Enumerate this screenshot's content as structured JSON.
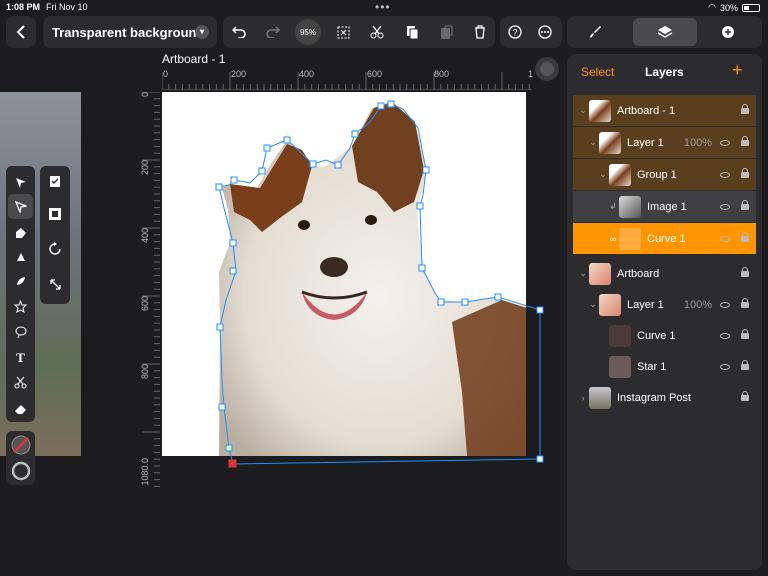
{
  "status": {
    "time": "1:08 PM",
    "date": "Fri Nov 10",
    "battery": "30%"
  },
  "document": {
    "title": "Transparent background",
    "zoom": "95%"
  },
  "artboard": {
    "label": "Artboard - 1"
  },
  "ruler": {
    "top_ticks": [
      "0",
      "200",
      "400",
      "600",
      "800",
      "1"
    ],
    "left_ticks": [
      "0",
      "200",
      "400",
      "600",
      "800",
      "1080.0"
    ]
  },
  "panel": {
    "select_label": "Select",
    "title": "Layers"
  },
  "layers": [
    {
      "name": "Artboard - 1",
      "indent": 0,
      "caret": "open",
      "thumb": "dog",
      "percent": "",
      "highlight": "brown"
    },
    {
      "name": "Layer 1",
      "indent": 1,
      "caret": "open",
      "thumb": "dog",
      "percent": "100%",
      "highlight": "brown"
    },
    {
      "name": "Group 1",
      "indent": 2,
      "caret": "open",
      "thumb": "dog",
      "percent": "",
      "highlight": "brown"
    },
    {
      "name": "Image 1",
      "indent": 3,
      "caret": "clip",
      "thumb": "image",
      "percent": "",
      "highlight": "gray"
    },
    {
      "name": "Curve 1",
      "indent": 3,
      "caret": "mask",
      "thumb": "curve",
      "percent": "",
      "highlight": "orange"
    },
    {
      "name": "Artboard",
      "indent": 0,
      "caret": "open",
      "thumb": "star",
      "percent": "",
      "highlight": "none"
    },
    {
      "name": "Layer 1",
      "indent": 1,
      "caret": "open",
      "thumb": "star",
      "percent": "100%",
      "highlight": "none"
    },
    {
      "name": "Curve 1",
      "indent": 2,
      "caret": "none",
      "thumb": "curve-dark",
      "percent": "",
      "highlight": "none"
    },
    {
      "name": "Star 1",
      "indent": 2,
      "caret": "none",
      "thumb": "star-small",
      "percent": "",
      "highlight": "none"
    },
    {
      "name": "Instagram Post",
      "indent": 0,
      "caret": "closed",
      "thumb": "photo",
      "percent": "",
      "highlight": "none"
    }
  ],
  "colors": {
    "accent": "#ff9500",
    "selection": "#1e90ff",
    "brown_highlight": "#5a3f1e"
  }
}
